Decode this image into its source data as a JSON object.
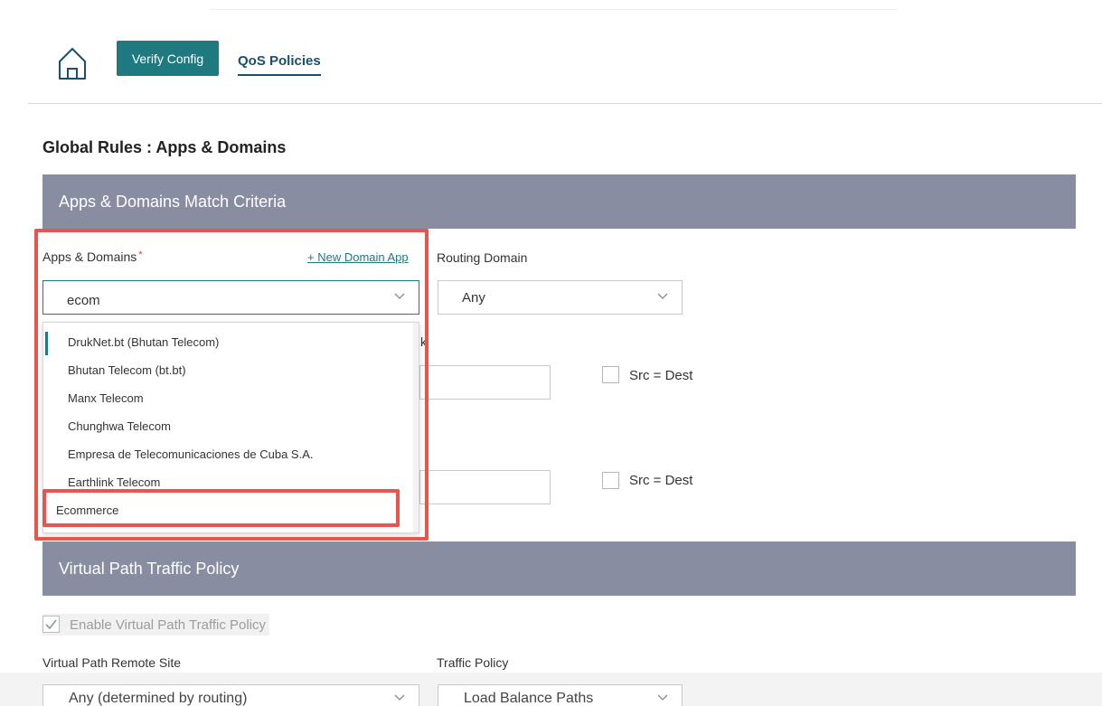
{
  "nav": {
    "verify_label": "Verify Config",
    "qos_tab_label": "QoS Policies"
  },
  "page_title": "Global Rules : Apps & Domains",
  "section_match": {
    "title": "Apps & Domains Match Criteria",
    "apps_label": "Apps & Domains",
    "required_mark": "*",
    "new_domain_link": "+ New Domain App",
    "apps_input_value": "ecom",
    "routing_label": "Routing Domain",
    "routing_value": "Any",
    "partial_char": "k",
    "src_dest_1": "Src = Dest",
    "src_dest_2": "Src = Dest"
  },
  "dropdown": {
    "options": [
      "DrukNet.bt (Bhutan Telecom)",
      "Bhutan Telecom (bt.bt)",
      "Manx Telecom",
      "Chunghwa Telecom",
      "Empresa de Telecomunicaciones de Cuba S.A.",
      "Earthlink Telecom",
      "Ecommerce"
    ]
  },
  "section_policy": {
    "title": "Virtual Path Traffic Policy",
    "enable_label": "Enable Virtual Path Traffic Policy",
    "enable_checked": true,
    "remote_site_label": "Virtual Path Remote Site",
    "remote_site_value": "Any (determined by routing)",
    "traffic_policy_label": "Traffic Policy",
    "traffic_policy_value": "Load Balance Paths"
  },
  "colors": {
    "accent": "#1f7a80",
    "section_header": "#898da1",
    "highlight": "#e8554e"
  }
}
